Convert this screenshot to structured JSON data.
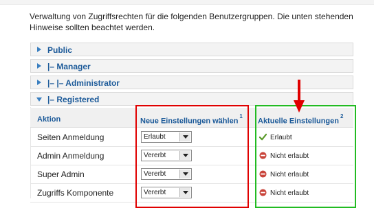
{
  "intro_text": "Verwaltung von Zugriffsrechten für die folgenden Benutzergruppen. Die unten stehenden Hinweise sollten beachtet werden.",
  "groups": [
    {
      "label": "Public",
      "expanded": false
    },
    {
      "label": "|– Manager",
      "expanded": false
    },
    {
      "label": "|– |– Administrator",
      "expanded": false
    },
    {
      "label": "|– Registered",
      "expanded": true
    }
  ],
  "table": {
    "col_action": "Aktion",
    "col_new": "Neue Einstellungen wählen",
    "col_new_note": "1",
    "col_current": "Aktuelle Einstellungen",
    "col_current_note": "2",
    "rows": [
      {
        "action": "Seiten Anmeldung",
        "select_value": "Erlaubt",
        "current": "Erlaubt",
        "current_icon": "check-icon"
      },
      {
        "action": "Admin Anmeldung",
        "select_value": "Vererbt",
        "current": "Nicht erlaubt",
        "current_icon": "denied-icon"
      },
      {
        "action": "Super Admin",
        "select_value": "Vererbt",
        "current": "Nicht erlaubt",
        "current_icon": "denied-icon"
      },
      {
        "action": "Zugriffs Komponente",
        "select_value": "Vererbt",
        "current": "Nicht erlaubt",
        "current_icon": "denied-icon"
      }
    ]
  },
  "colors": {
    "link": "#1c5a99",
    "highlight_new": "#e00000",
    "highlight_current": "#22bb22",
    "allowed": "#5a9a2a",
    "denied": "#c9443a"
  }
}
